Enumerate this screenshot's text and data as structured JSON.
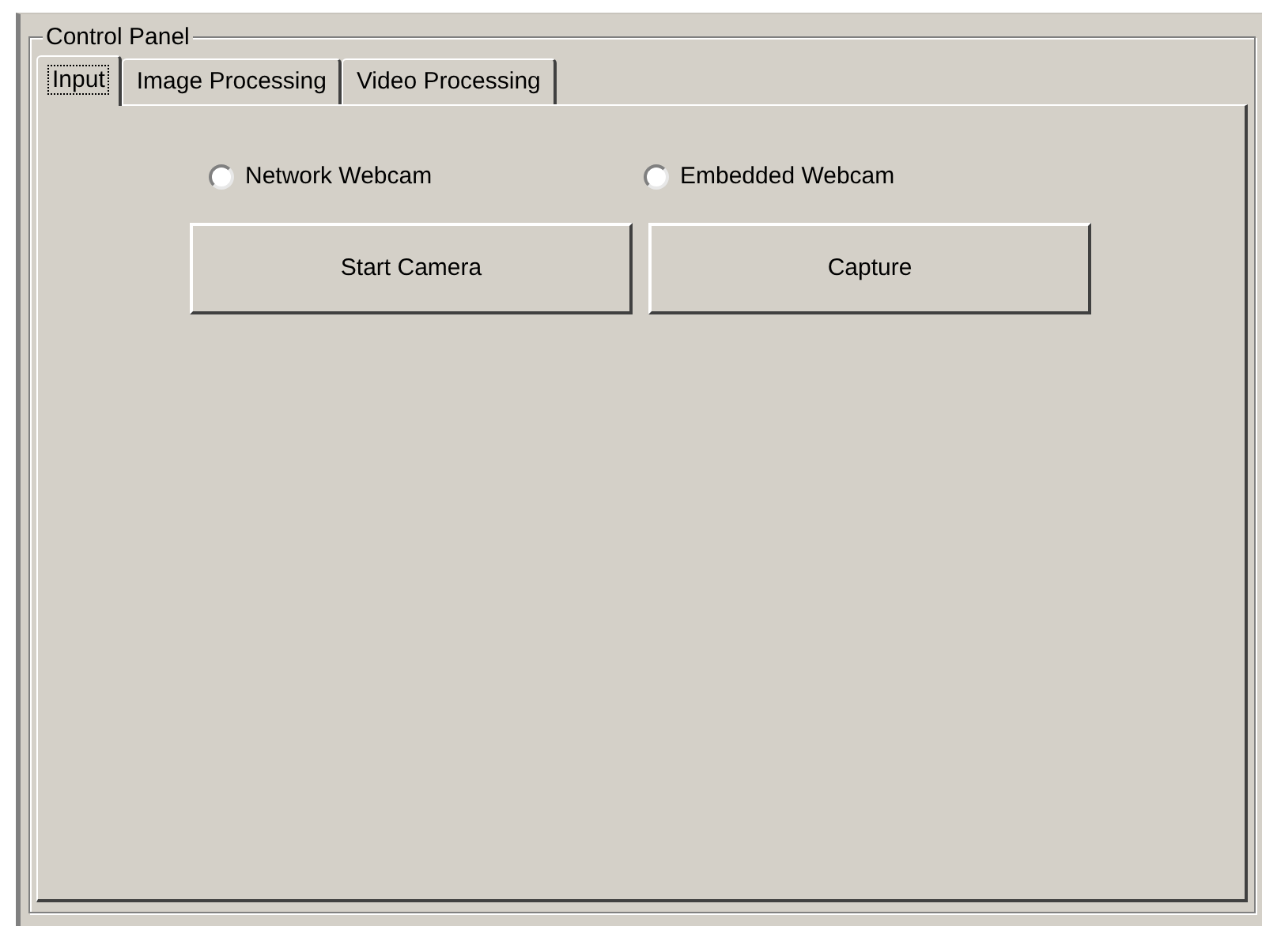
{
  "group": {
    "title": "Control Panel"
  },
  "tabs": [
    {
      "label": "Input",
      "selected": true
    },
    {
      "label": "Image Processing",
      "selected": false
    },
    {
      "label": "Video Processing",
      "selected": false
    }
  ],
  "sources": [
    {
      "label": "Network Webcam",
      "selected": false
    },
    {
      "label": "Embedded Webcam",
      "selected": false
    }
  ],
  "buttons": [
    "Start Camera",
    "Capture"
  ]
}
